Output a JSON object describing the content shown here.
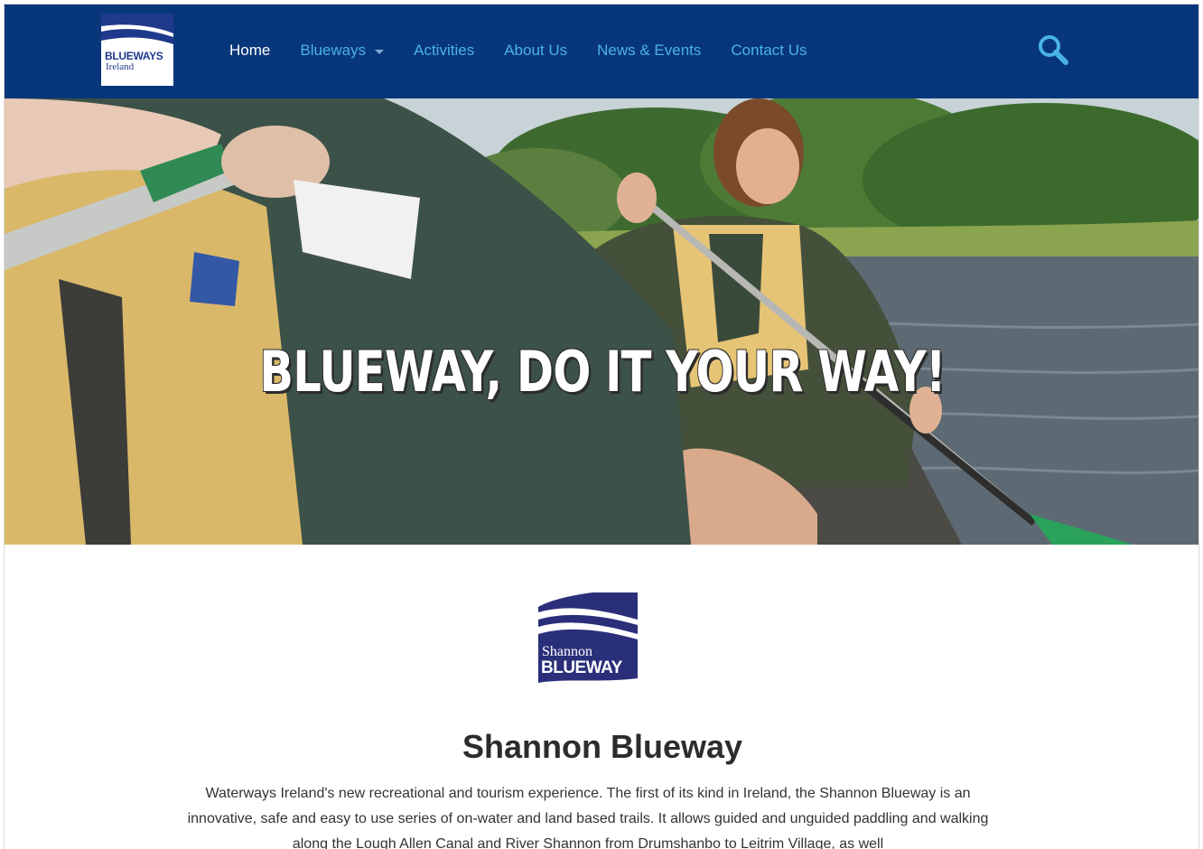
{
  "brand": {
    "logo_line1": "BLUEWAYS",
    "logo_line2": "Ireland",
    "logo_icon": "blueways-ireland-logo",
    "primary_color": "#08367a",
    "accent_color": "#49b2e8"
  },
  "nav": {
    "items": [
      {
        "label": "Home",
        "active": true
      },
      {
        "label": "Blueways",
        "dropdown": true
      },
      {
        "label": "Activities"
      },
      {
        "label": "About Us"
      },
      {
        "label": "News & Events"
      },
      {
        "label": "Contact Us"
      }
    ],
    "search_icon": "search-icon"
  },
  "hero": {
    "title": "BLUEWAY, DO IT YOUR WAY!"
  },
  "section": {
    "logo_line1": "Shannon",
    "logo_line2": "BLUEWAY",
    "logo_color": "#2a2f7a",
    "title": "Shannon Blueway",
    "body": "Waterways Ireland's new recreational and tourism experience. The first of its kind in Ireland, the Shannon Blueway is an innovative, safe and easy to use series of on-water and land based trails. It allows guided and unguided paddling and walking along the Lough Allen Canal and River Shannon from Drumshanbo to Leitrim Village, as well"
  }
}
